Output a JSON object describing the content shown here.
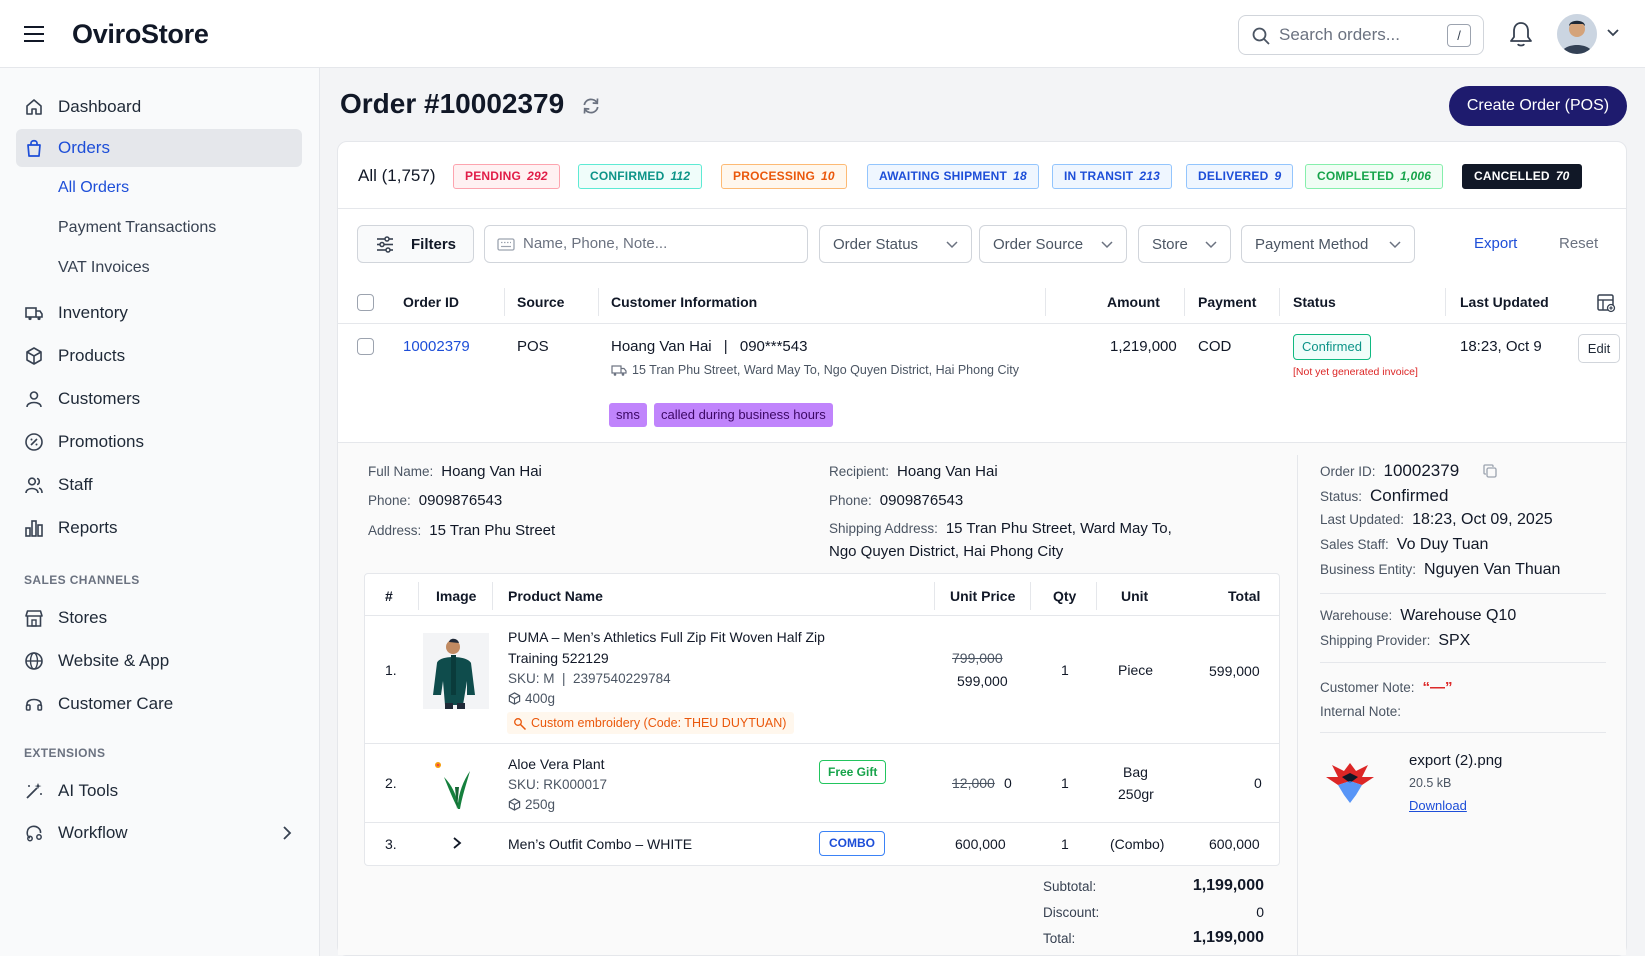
{
  "app": {
    "brand": "OviroStore"
  },
  "topbar": {
    "search_placeholder": "Search orders...",
    "search_shortcut": "/"
  },
  "sidebar": {
    "items": [
      {
        "label": "Dashboard"
      },
      {
        "label": "Orders"
      },
      {
        "label": "Inventory"
      },
      {
        "label": "Products"
      },
      {
        "label": "Customers"
      },
      {
        "label": "Promotions"
      },
      {
        "label": "Staff"
      },
      {
        "label": "Reports"
      }
    ],
    "orders_sub": [
      "All Orders",
      "Payment Transactions",
      "VAT Invoices"
    ],
    "sales_channels_title": "SALES CHANNELS",
    "sales_channels": [
      "Stores",
      "Website & App",
      "Customer Care"
    ],
    "extensions_title": "EXTENSIONS",
    "extensions": [
      "AI Tools",
      "Workflow"
    ]
  },
  "page": {
    "title": "Order #10002379",
    "create_button": "Create Order (POS)"
  },
  "status_tabs": {
    "all": "All (1,757)",
    "pills": [
      {
        "label": "PENDING",
        "count": "292",
        "color": "#e11d48",
        "border": "#fda4af",
        "bg": "#fff1f2"
      },
      {
        "label": "CONFIRMED",
        "count": "112",
        "color": "#0d9488",
        "border": "#5eead4",
        "bg": "#f0fdfa"
      },
      {
        "label": "PROCESSING",
        "count": "10",
        "color": "#ea580c",
        "border": "#fdba74",
        "bg": "#fff7ed"
      },
      {
        "label": "AWAITING SHIPMENT",
        "count": "18",
        "color": "#1d4ed8",
        "border": "#93c5fd",
        "bg": "#eff6ff"
      },
      {
        "label": "IN TRANSIT",
        "count": "213",
        "color": "#1d4ed8",
        "border": "#93c5fd",
        "bg": "#eff6ff"
      },
      {
        "label": "DELIVERED",
        "count": "9",
        "color": "#1d4ed8",
        "border": "#93c5fd",
        "bg": "#eff6ff"
      },
      {
        "label": "COMPLETED",
        "count": "1,006",
        "color": "#16a34a",
        "border": "#86efac",
        "bg": "#f0fdf4"
      },
      {
        "label": "CANCELLED",
        "count": "70",
        "color": "#ffffff",
        "border": "#111827",
        "bg": "#111827"
      }
    ]
  },
  "filters": {
    "button": "Filters",
    "search_placeholder": "Name, Phone, Note...",
    "order_status": "Order Status",
    "order_source": "Order Source",
    "store": "Store",
    "payment_method": "Payment Method",
    "export": "Export",
    "reset": "Reset"
  },
  "orders_table": {
    "headers": [
      "Order ID",
      "Source",
      "Customer Information",
      "Amount",
      "Payment",
      "Status",
      "Last Updated"
    ],
    "row": {
      "order_id": "10002379",
      "source": "POS",
      "customer": "Hoang Van Hai",
      "phone_sep": "|",
      "phone": "090***543",
      "address": "15 Tran Phu Street, Ward May To, Ngo Quyen District, Hai Phong City",
      "tags": [
        "sms",
        "called during business hours"
      ],
      "amount": "1,219,000",
      "payment": "COD",
      "status": "Confirmed",
      "invoice_note": "[Not yet generated invoice]",
      "last_updated": "18:23, Oct 9",
      "edit": "Edit"
    }
  },
  "detail": {
    "customer": {
      "full_name_label": "Full Name:",
      "full_name": "Hoang Van Hai",
      "phone_label": "Phone:",
      "phone": "0909876543",
      "address_label": "Address:",
      "address": "15 Tran Phu Street"
    },
    "recipient": {
      "recipient_label": "Recipient:",
      "recipient": "Hoang Van Hai",
      "phone_label": "Phone:",
      "phone": "0909876543",
      "shipping_label": "Shipping Address:",
      "shipping_line1": "15 Tran Phu Street, Ward May To,",
      "shipping_line2": "Ngo Quyen District, Hai Phong City"
    },
    "right": {
      "order_id_label": "Order ID:",
      "order_id": "10002379",
      "status_label": "Status:",
      "status": "Confirmed",
      "last_updated_label": "Last Updated:",
      "last_updated": "18:23, Oct 09, 2025",
      "sales_staff_label": "Sales Staff:",
      "sales_staff": "Vo Duy Tuan",
      "business_label": "Business Entity:",
      "business": "Nguyen Van Thuan",
      "warehouse_label": "Warehouse:",
      "warehouse": "Warehouse Q10",
      "shipping_label": "Shipping Provider:",
      "shipping": "SPX",
      "customer_note_label": "Customer Note:",
      "customer_note": "“—”",
      "internal_note_label": "Internal Note:",
      "file_name": "export (2).png",
      "file_size": "20.5 kB",
      "download": "Download"
    }
  },
  "products": {
    "headers": [
      "#",
      "Image",
      "Product Name",
      "Unit Price",
      "Qty",
      "Unit",
      "Total"
    ],
    "rows": [
      {
        "idx": "1.",
        "name_line1": "PUMA – Men’s Athletics Full Zip Fit Woven Half Zip",
        "name_line2": "Training 522129",
        "sku": "SKU: M  |  2397540229784",
        "weight": "400g",
        "embroidery": "Custom embroidery (Code: THEU DUYTUAN)",
        "old_price": "799,000",
        "price": "599,000",
        "qty": "1",
        "unit": "Piece",
        "total": "599,000"
      },
      {
        "idx": "2.",
        "name_line1": "Aloe Vera Plant",
        "sku": "SKU: RK000017",
        "weight": "250g",
        "badge": "Free Gift",
        "old_price": "12,000",
        "price": "0",
        "qty": "1",
        "unit_line1": "Bag",
        "unit_line2": "250gr",
        "total": "0"
      },
      {
        "idx": "3.",
        "name_line1": "Men’s Outfit Combo – WHITE",
        "badge": "COMBO",
        "price": "600,000",
        "qty": "1",
        "unit": "(Combo)",
        "total": "600,000"
      }
    ]
  },
  "summary": {
    "subtotal_label": "Subtotal:",
    "subtotal": "1,199,000",
    "discount_label": "Discount:",
    "discount": "0",
    "total_label": "Total:",
    "total": "1,199,000"
  }
}
